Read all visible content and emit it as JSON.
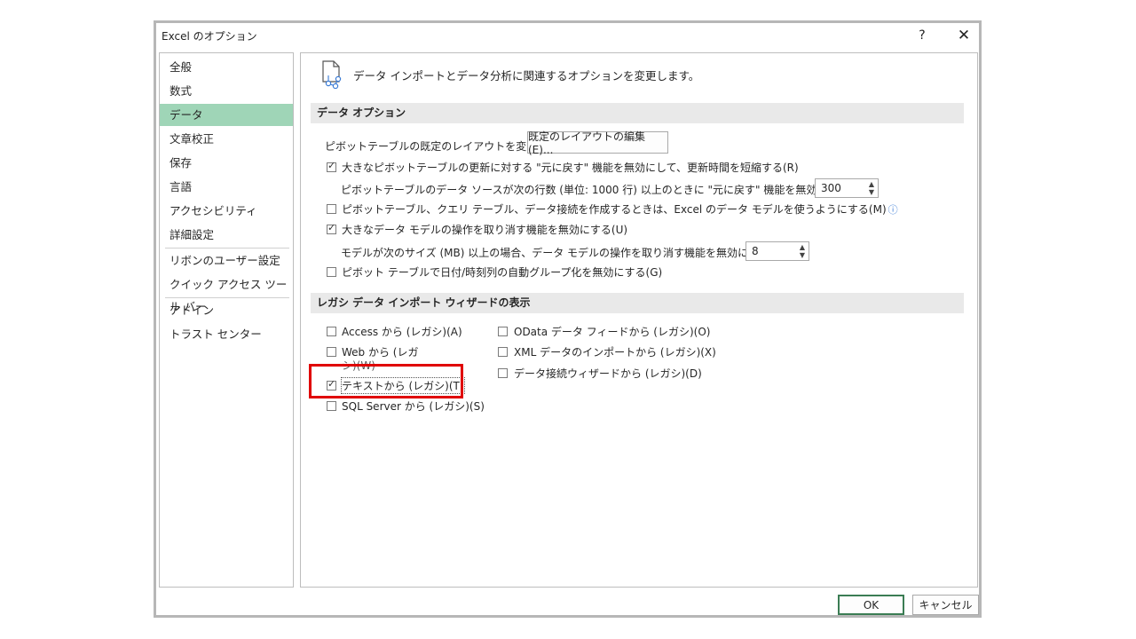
{
  "window": {
    "title": "Excel のオプション",
    "help_glyph": "?",
    "close_glyph": "✕"
  },
  "nav": {
    "items": [
      {
        "label": "全般"
      },
      {
        "label": "数式"
      },
      {
        "label": "データ",
        "active": true
      },
      {
        "label": "文章校正"
      },
      {
        "label": "保存"
      },
      {
        "label": "言語"
      },
      {
        "label": "アクセシビリティ"
      },
      {
        "label": "詳細設定"
      },
      {
        "label": "リボンのユーザー設定"
      },
      {
        "label": "クイック アクセス ツール バー"
      },
      {
        "label": "アドイン"
      },
      {
        "label": "トラスト センター"
      }
    ]
  },
  "content": {
    "header_text": "データ インポートとデータ分析に関連するオプションを変更します。",
    "header_icon": "document-data-icon",
    "data_options": {
      "section_title": "データ オプション",
      "default_layout_label": "ピボットテーブルの既定のレイアウトを変更する:",
      "default_layout_button": "既定のレイアウトの編集(E)...",
      "opt_undo_large_pivot": {
        "label": "大きなピボットテーブルの更新に対する \"元に戻す\" 機能を無効にして、更新時間を短縮する(R)",
        "checked": true
      },
      "undo_rows_label": "ピボットテーブルのデータ ソースが次の行数 (単位: 1000 行) 以上のときに \"元に戻す\" 機能を無効にする(N):",
      "undo_rows_value": "300",
      "opt_use_data_model": {
        "label": "ピボットテーブル、クエリ テーブル、データ接続を作成するときは、Excel のデータ モデルを使うようにする(M)",
        "checked": false
      },
      "info_glyph": "ⓘ",
      "opt_undo_large_model": {
        "label": "大きなデータ モデルの操作を取り消す機能を無効にする(U)",
        "checked": true
      },
      "model_size_label": "モデルが次のサイズ (MB) 以上の場合、データ モデルの操作を取り消す機能を無効にする(L):",
      "model_size_value": "8",
      "opt_disable_autogroup": {
        "label": "ピボット テーブルで日付/時刻列の自動グループ化を無効にする(G)",
        "checked": false
      }
    },
    "legacy": {
      "section_title": "レガシ データ インポート ウィザードの表示",
      "access": {
        "label": "Access から (レガシ)(A)",
        "checked": false
      },
      "web_line1": "Web から (レガ",
      "web_line2": "シ)(W)",
      "web_checked": false,
      "text": {
        "label": "テキストから (レガシ)(T)",
        "checked": true
      },
      "sql": {
        "label": "SQL Server から (レガシ)(S)",
        "checked": false
      },
      "odata": {
        "label": "OData データ フィードから (レガシ)(O)",
        "checked": false
      },
      "xml": {
        "label": "XML データのインポートから (レガシ)(X)",
        "checked": false
      },
      "wizard": {
        "label": "データ接続ウィザードから (レガシ)(D)",
        "checked": false
      }
    }
  },
  "footer": {
    "ok_label": "OK",
    "cancel_label": "キャンセル"
  },
  "colors": {
    "nav_active": "#9fd5b7",
    "highlight": "#e00000",
    "ok_border": "#3b7d54"
  }
}
